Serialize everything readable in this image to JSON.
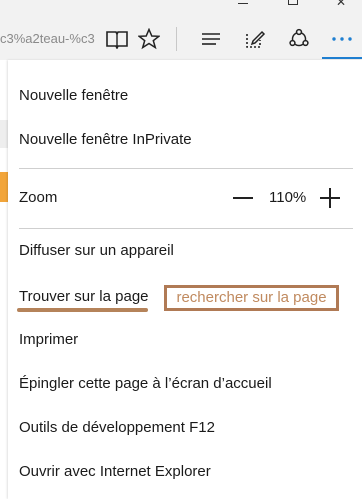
{
  "browser": {
    "address_text": "c3%a2teau-%c3",
    "toolbar_icons": [
      "reading-view-icon",
      "favorite-star-icon",
      "hub-icon",
      "web-note-icon",
      "share-icon",
      "more-icon"
    ],
    "window_controls": [
      "minimize-icon",
      "maximize-icon",
      "close-icon"
    ],
    "accent_color": "#1f7fd1"
  },
  "menu": {
    "new_window": "Nouvelle fenêtre",
    "new_private_window": "Nouvelle fenêtre InPrivate",
    "zoom_label": "Zoom",
    "zoom_value": "110%",
    "cast": "Diffuser sur un appareil",
    "find_on_page": "Trouver sur la page",
    "print": "Imprimer",
    "pin_start": "Épingler cette page à l’écran d’accueil",
    "dev_tools": "Outils de développement F12",
    "open_ie": "Ouvrir avec Internet Explorer"
  },
  "annotation": {
    "text": "rechercher sur la page",
    "color": "#b07a55"
  }
}
